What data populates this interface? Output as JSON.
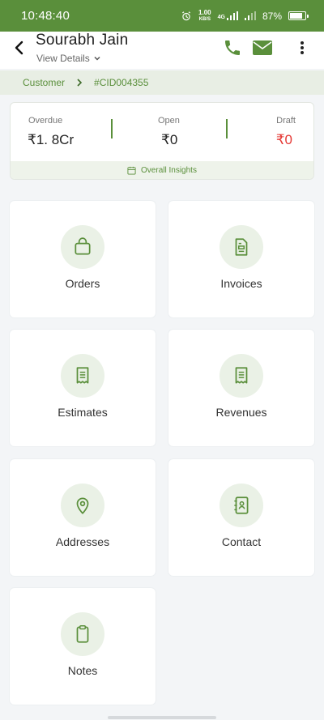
{
  "status_bar": {
    "time": "10:48:40",
    "net_speed_value": "1.00",
    "net_speed_unit": "KB/S",
    "network": "4G",
    "battery_level": 0.87,
    "battery_label": "87%"
  },
  "header": {
    "name": "Sourabh Jain",
    "view_details": "View Details"
  },
  "breadcrumb": {
    "parent": "Customer",
    "current": "#CID004355"
  },
  "summary": {
    "overdue_label": "Overdue",
    "overdue_value": "₹1. 8Cr",
    "open_label": "Open",
    "open_value": "₹0",
    "draft_label": "Draft",
    "draft_value": "₹0",
    "insights_label": "Overall Insights"
  },
  "tiles": {
    "orders": "Orders",
    "invoices": "Invoices",
    "estimates": "Estimates",
    "revenues": "Revenues",
    "addresses": "Addresses",
    "contact": "Contact",
    "notes": "Notes"
  },
  "colors": {
    "brand": "#5a8f3b",
    "draft_value": "#e53935"
  },
  "icons": {
    "orders": "shopping-bag-icon",
    "invoices": "document-icon",
    "estimates": "receipt-icon",
    "revenues": "receipt-icon",
    "addresses": "location-pin-icon",
    "contact": "contact-book-icon",
    "notes": "clipboard-icon"
  }
}
